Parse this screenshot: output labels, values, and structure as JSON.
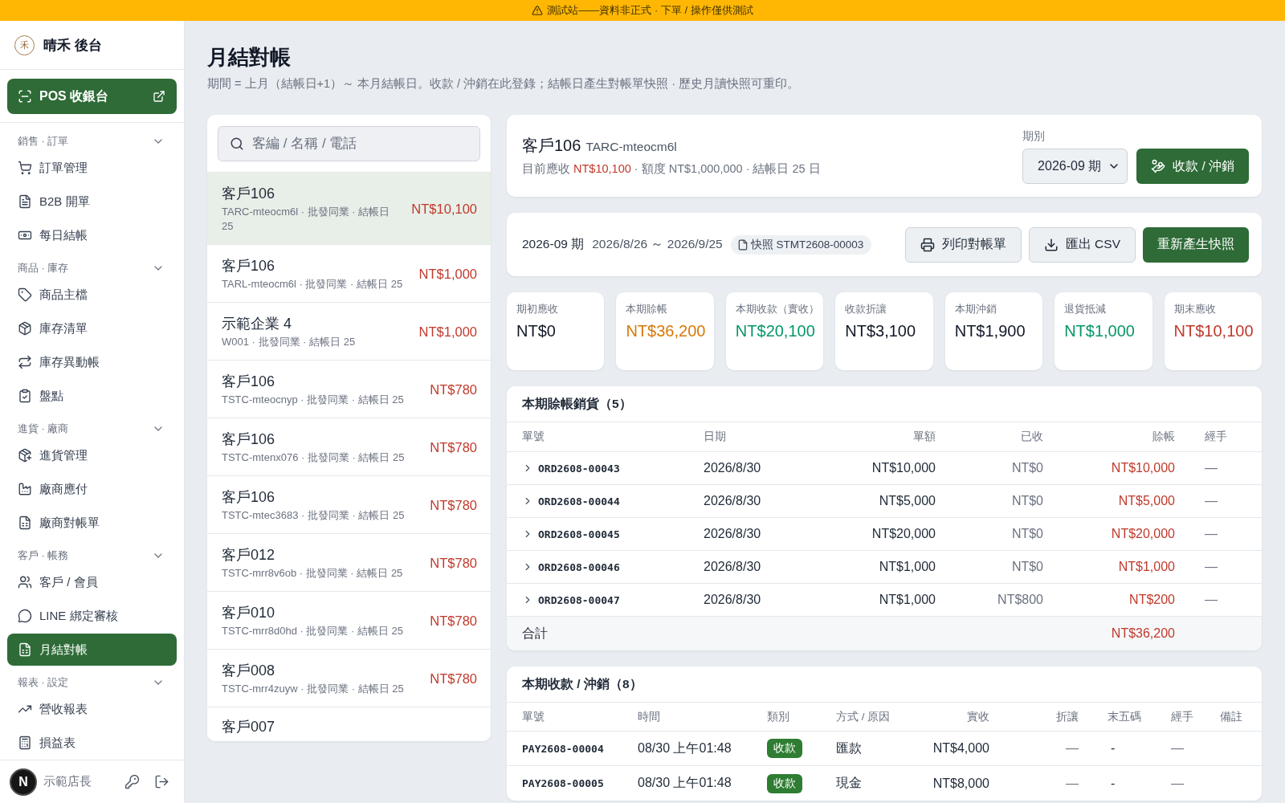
{
  "banner": {
    "text": "測試站——資料非正式 · 下單 / 操作僅供測試"
  },
  "sidebar": {
    "logo": "禾",
    "brand": "晴禾 後台",
    "pos_button": "POS 收銀台",
    "groups": [
      {
        "title": "銷售 · 訂單",
        "expanded": true,
        "items": [
          {
            "label": "訂單管理",
            "selected": false
          },
          {
            "label": "B2B 開單",
            "selected": false
          },
          {
            "label": "每日結帳",
            "selected": false
          }
        ]
      },
      {
        "title": "商品 · 庫存",
        "expanded": true,
        "items": [
          {
            "label": "商品主檔",
            "selected": false
          },
          {
            "label": "庫存清單",
            "selected": false
          },
          {
            "label": "庫存異動帳",
            "selected": false
          },
          {
            "label": "盤點",
            "selected": false
          }
        ]
      },
      {
        "title": "進貨 · 廠商",
        "expanded": true,
        "items": [
          {
            "label": "進貨管理",
            "selected": false
          },
          {
            "label": "廠商應付",
            "selected": false
          },
          {
            "label": "廠商對帳單",
            "selected": false
          }
        ]
      },
      {
        "title": "客戶 · 帳務",
        "expanded": true,
        "items": [
          {
            "label": "客戶 / 會員",
            "selected": false
          },
          {
            "label": "LINE 綁定審核",
            "selected": false
          },
          {
            "label": "月結對帳",
            "selected": true
          }
        ]
      },
      {
        "title": "報表 · 設定",
        "expanded": true,
        "items": [
          {
            "label": "營收報表",
            "selected": false
          },
          {
            "label": "損益表",
            "selected": false
          }
        ]
      }
    ],
    "dev_badge": "N",
    "user": "示範店長"
  },
  "page": {
    "title": "月結對帳",
    "subtitle": "期間 = 上月（結帳日+1）～ 本月結帳日。收款 / 沖銷在此登錄；結帳日產生對帳單快照 · 歷史月讀快照可重印。"
  },
  "customers": {
    "search": {
      "placeholder": "客編 / 名稱 / 電話"
    },
    "items": [
      {
        "name": "客戶106",
        "meta": "TARC-mteocm6l · 批發同業 · 結帳日 25",
        "balance": "NT$10,100",
        "selected": true
      },
      {
        "name": "客戶106",
        "meta": "TARL-mteocm6l · 批發同業 · 結帳日 25",
        "balance": "NT$1,000",
        "selected": false
      },
      {
        "name": "示範企業 4",
        "meta": "W001 · 批發同業 · 結帳日 25",
        "balance": "NT$1,000",
        "selected": false
      },
      {
        "name": "客戶106",
        "meta": "TSTC-mteocnyp · 批發同業 · 結帳日 25",
        "balance": "NT$780",
        "selected": false
      },
      {
        "name": "客戶106",
        "meta": "TSTC-mtenx076 · 批發同業 · 結帳日 25",
        "balance": "NT$780",
        "selected": false
      },
      {
        "name": "客戶106",
        "meta": "TSTC-mtec3683 · 批發同業 · 結帳日 25",
        "balance": "NT$780",
        "selected": false
      },
      {
        "name": "客戶012",
        "meta": "TSTC-mrr8v6ob · 批發同業 · 結帳日 25",
        "balance": "NT$780",
        "selected": false
      },
      {
        "name": "客戶010",
        "meta": "TSTC-mrr8d0hd · 批發同業 · 結帳日 25",
        "balance": "NT$780",
        "selected": false
      },
      {
        "name": "客戶008",
        "meta": "TSTC-mrr4zuyw · 批發同業 · 結帳日 25",
        "balance": "NT$780",
        "selected": false
      },
      {
        "name": "客戶007",
        "selected": false
      }
    ]
  },
  "account": {
    "name": "客戶106",
    "code": "TARC-mteocm6l",
    "receivable_label": "目前應收",
    "receivable": "NT$10,100",
    "details": "· 額度 NT$1,000,000 · 結帳日 25 日",
    "period_label": "期別",
    "period_value": "2026-09 期",
    "action": "收款 / 沖銷"
  },
  "statement": {
    "period": "2026-09 期",
    "range": "2026/8/26 ～ 2026/9/25",
    "snapshot": "快照 STMT2608-00003",
    "buttons": [
      {
        "label": "列印對帳單",
        "kind": "print"
      },
      {
        "label": "匯出 CSV",
        "kind": "export"
      },
      {
        "label": "重新產生快照",
        "kind": "primary"
      }
    ]
  },
  "stats": [
    {
      "label": "期初應收",
      "value": "NT$0",
      "color": "#111827"
    },
    {
      "label": "本期賒帳",
      "value": "NT$36,200",
      "color": "#d97706"
    },
    {
      "label": "本期收款（實收）",
      "value": "NT$20,100",
      "color": "#059669"
    },
    {
      "label": "收款折讓",
      "value": "NT$3,100",
      "color": "#111827"
    },
    {
      "label": "本期沖銷",
      "value": "NT$1,900",
      "color": "#111827"
    },
    {
      "label": "退貨抵減",
      "value": "NT$1,000",
      "color": "#059669"
    },
    {
      "label": "期末應收",
      "value": "NT$10,100",
      "color": "#c0392b"
    }
  ],
  "sales_table": {
    "title": "本期賒帳銷貨（5）",
    "columns": [
      "單號",
      "日期",
      "單額",
      "已收",
      "賒帳",
      "經手"
    ],
    "rows": [
      {
        "order": "ORD2608-00043",
        "date": "2026/8/30",
        "amount": "NT$10,000",
        "paid": "NT$0",
        "credit": "NT$10,000",
        "handler": "—",
        "expanded": false
      },
      {
        "order": "ORD2608-00044",
        "date": "2026/8/30",
        "amount": "NT$5,000",
        "paid": "NT$0",
        "credit": "NT$5,000",
        "handler": "—",
        "expanded": false
      },
      {
        "order": "ORD2608-00045",
        "date": "2026/8/30",
        "amount": "NT$20,000",
        "paid": "NT$0",
        "credit": "NT$20,000",
        "handler": "—",
        "expanded": false
      },
      {
        "order": "ORD2608-00046",
        "date": "2026/8/30",
        "amount": "NT$1,000",
        "paid": "NT$0",
        "credit": "NT$1,000",
        "handler": "—",
        "expanded": false
      },
      {
        "order": "ORD2608-00047",
        "date": "2026/8/30",
        "amount": "NT$1,000",
        "paid": "NT$800",
        "credit": "NT$200",
        "handler": "—",
        "expanded": false
      }
    ],
    "total": {
      "label": "合計",
      "credit": "NT$36,200"
    }
  },
  "payments_table": {
    "title": "本期收款 / 沖銷（8）",
    "columns": [
      "單號",
      "時間",
      "類別",
      "方式 / 原因",
      "實收",
      "折讓",
      "末五碼",
      "經手",
      "備註"
    ],
    "rows": [
      {
        "number": "PAY2608-00004",
        "time": "08/30 上午01:48",
        "type": "收款",
        "method": "匯款",
        "received": "NT$4,000",
        "discount": "—",
        "last5": "-",
        "handler": "—"
      },
      {
        "number": "PAY2608-00005",
        "time": "08/30 上午01:48",
        "type": "收款",
        "method": "現金",
        "received": "NT$8,000",
        "discount": "—",
        "last5": "-",
        "handler": "—"
      }
    ]
  }
}
